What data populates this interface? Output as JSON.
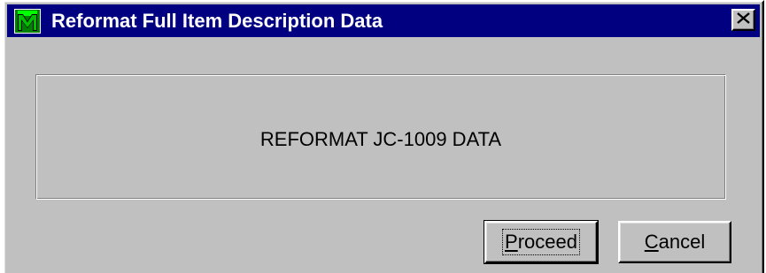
{
  "window": {
    "title": "Reformat Full Item Description Data",
    "icon": "app-m-icon",
    "close_icon": "close-icon"
  },
  "content": {
    "message": "REFORMAT JC-1009 DATA"
  },
  "buttons": {
    "proceed": {
      "mnemonic": "P",
      "rest": "roceed",
      "focused": true
    },
    "cancel": {
      "mnemonic": "C",
      "rest": "ancel"
    }
  },
  "colors": {
    "titlebar": "#000080",
    "face": "#c0c0c0",
    "title_text": "#ffffff"
  }
}
